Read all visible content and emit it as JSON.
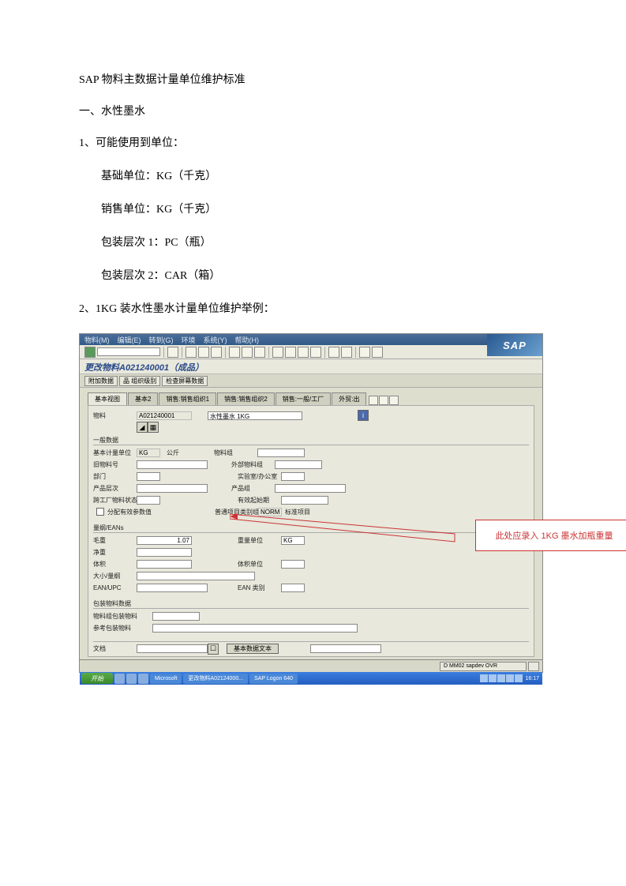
{
  "document": {
    "title": "SAP 物料主数据计量单位维护标准",
    "section1": "一、水性墨水",
    "list1_lead": "1、可能使用到单位：",
    "list1_items": {
      "base": "基础单位：KG（千克）",
      "sales": "销售单位：KG（千克）",
      "pack1": "包装层次 1：PC（瓶）",
      "pack2": "包装层次 2：CAR（箱）"
    },
    "list2_lead": "2、1KG 装水性墨水计量单位维护举例："
  },
  "sap": {
    "logo": "SAP",
    "menu": {
      "m1": "物料(M)",
      "m2": "编辑(E)",
      "m3": "转到(G)",
      "m4": "环境",
      "m5": "系统(Y)",
      "m6": "帮助(H)"
    },
    "screen_title": "更改物料A021240001（成品）",
    "toolbar2": {
      "b1": "附加数据",
      "b2": "品 组织级别",
      "b3": "检查屏幕数据"
    },
    "tabs": {
      "t1": "基本视图",
      "t2": "基本2",
      "t3": "销售:销售组织1",
      "t4": "销售:销售组织2",
      "t5": "销售:一般/工厂",
      "t6": "外贸:出"
    },
    "header": {
      "material_label": "物料",
      "material_value": "A021240001",
      "material_desc": "水性墨水 1KG"
    },
    "general": {
      "group_label": "一般数据",
      "base_uom_label": "基本计量单位",
      "base_uom_val": "KG",
      "base_uom_txt": "公斤",
      "matgroup_label": "物料组",
      "old_matno_label": "旧物料号",
      "ext_matgroup_label": "外部物料组",
      "division_label": "部门",
      "lab_label": "实验室/办公室",
      "prod_hier_label": "产品层次",
      "prod_hier2_label": "产品组",
      "cross_plant_label": "跨工厂物料状态",
      "valid_from_label": "有效起始期",
      "assign_eff_label": "分配有效参数值",
      "gen_item_cat_label": "普通项目类别组",
      "gen_item_cat_val": "NORM",
      "gen_item_cat_txt": "标准项目"
    },
    "dimension": {
      "group_label": "量纲/EANs",
      "gross_weight_label": "毛重",
      "gross_weight_val": "1.07",
      "weight_unit_label": "重量单位",
      "weight_unit_val": "KG",
      "net_weight_label": "净重",
      "volume_label": "体积",
      "volume_unit_label": "体积单位",
      "size_label": "大小/量纲",
      "ean_label": "EAN/UPC",
      "ean_cat_label": "EAN 类别"
    },
    "pack": {
      "group_label": "包装物料数据",
      "matgroup_label": "物料组包装物料",
      "ref_label": "参考包装物料"
    },
    "doc": {
      "doc_label": "文档",
      "doc_btn": "基本数据文本"
    },
    "status": {
      "cell": "D   MM02   sapdev   OVR"
    },
    "taskbar": {
      "start": "开始",
      "w1": "Microsoft",
      "w2": "更改物料A02124000...",
      "w3": "SAP Logon 640"
    }
  },
  "callout": "此处应录入 1KG 墨水加瓶重量",
  "taskbar_time": "16:17"
}
